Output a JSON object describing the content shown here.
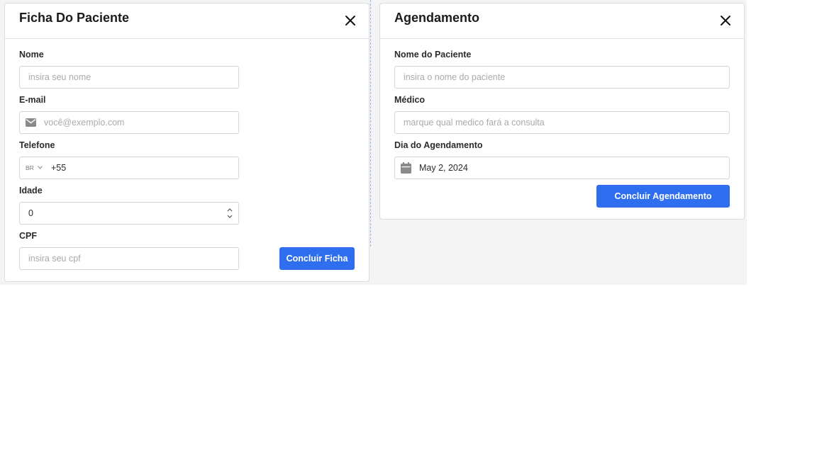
{
  "ficha": {
    "title": "Ficha Do Paciente",
    "fields": {
      "nome": {
        "label": "Nome",
        "placeholder": "insira seu nome"
      },
      "email": {
        "label": "E-mail",
        "placeholder": "você@exemplo.com"
      },
      "telefone": {
        "label": "Telefone",
        "country": "BR",
        "value": "+55"
      },
      "idade": {
        "label": "Idade",
        "value": "0"
      },
      "cpf": {
        "label": "CPF",
        "placeholder": "insira seu cpf"
      }
    },
    "submit_label": "Concluir Ficha"
  },
  "agendamento": {
    "title": "Agendamento",
    "fields": {
      "paciente": {
        "label": "Nome do Paciente",
        "placeholder": "insira o nome do paciente"
      },
      "medico": {
        "label": "Médico",
        "placeholder": "marque qual medico fará a consulta"
      },
      "dia": {
        "label": "Dia do Agendamento",
        "value": "May 2, 2024"
      }
    },
    "submit_label": "Concluir Agendamento"
  },
  "icons": {
    "close": "close-icon",
    "email": "mail-icon",
    "calendar": "calendar-icon",
    "country_dropdown": "chevron-down-icon",
    "number_spinner": "spinner-icon"
  },
  "colors": {
    "primary": "#2f6fef",
    "canvas": "#f4f4f4",
    "border": "#d4d4d4"
  }
}
